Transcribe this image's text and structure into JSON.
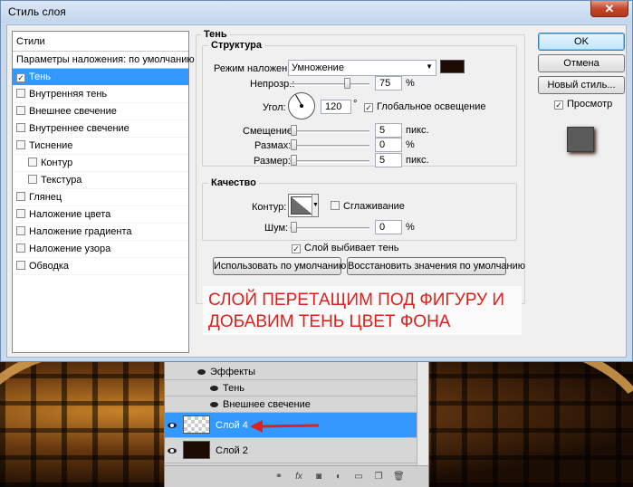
{
  "window": {
    "title": "Стиль слоя",
    "close_glyph": "✕"
  },
  "styles_panel": {
    "header": "Стили",
    "params_label": "Параметры наложения: по умолчанию",
    "items": [
      {
        "label": "Тень",
        "checked": true,
        "selected": true,
        "indent": false
      },
      {
        "label": "Внутренняя тень",
        "checked": false,
        "selected": false,
        "indent": false
      },
      {
        "label": "Внешнее свечение",
        "checked": false,
        "selected": false,
        "indent": false
      },
      {
        "label": "Внутреннее свечение",
        "checked": false,
        "selected": false,
        "indent": false
      },
      {
        "label": "Тиснение",
        "checked": false,
        "selected": false,
        "indent": false
      },
      {
        "label": "Контур",
        "checked": false,
        "selected": false,
        "indent": true
      },
      {
        "label": "Текстура",
        "checked": false,
        "selected": false,
        "indent": true
      },
      {
        "label": "Глянец",
        "checked": false,
        "selected": false,
        "indent": false
      },
      {
        "label": "Наложение цвета",
        "checked": false,
        "selected": false,
        "indent": false
      },
      {
        "label": "Наложение градиента",
        "checked": false,
        "selected": false,
        "indent": false
      },
      {
        "label": "Наложение узора",
        "checked": false,
        "selected": false,
        "indent": false
      },
      {
        "label": "Обводка",
        "checked": false,
        "selected": false,
        "indent": false
      }
    ]
  },
  "shadow": {
    "group_title": "Тень",
    "structure": {
      "title": "Структура",
      "blend_mode_label": "Режим наложения:",
      "blend_mode_value": "Умножение",
      "shadow_color": "#1d0c03",
      "opacity_label": "Непрозр.:",
      "opacity_value": "75",
      "opacity_unit": "%",
      "opacity_fraction": 0.75,
      "angle_label": "Угол:",
      "angle_value": "120",
      "angle_unit": "°",
      "global_light_label": "Глобальное освещение",
      "global_light_checked": true,
      "offset_label": "Смещение:",
      "offset_value": "5",
      "offset_unit": "пикс.",
      "spread_label": "Размах:",
      "spread_value": "0",
      "spread_unit": "%",
      "size_label": "Размер:",
      "size_value": "5",
      "size_unit": "пикс."
    },
    "quality": {
      "title": "Качество",
      "contour_label": "Контур:",
      "antialias_label": "Сглаживание",
      "antialias_checked": false,
      "noise_label": "Шум:",
      "noise_value": "0",
      "noise_unit": "%"
    },
    "knockout_label": "Слой выбивает тень",
    "knockout_checked": true,
    "use_default_button": "Использовать по умолчанию",
    "restore_default_button": "Восстановить значения по умолчанию"
  },
  "note": {
    "line1": "СЛОЙ ПЕРЕТАЩИМ ПОД ФИГУРУ И",
    "line2": "ДОБАВИМ ТЕНЬ ЦВЕТ ФОНА",
    "color": "#e0201a"
  },
  "right_panel": {
    "ok_button": "OK",
    "cancel_button": "Отмена",
    "new_style_button": "Новый стиль...",
    "preview_label": "Просмотр",
    "preview_checked": true
  },
  "layers_panel": {
    "effects_label": "Эффекты",
    "effect_items": [
      "Тень",
      "Внешнее свечение"
    ],
    "layers": [
      {
        "name": "Слой 4",
        "selected": true
      },
      {
        "name": "Слой 2",
        "selected": false
      }
    ],
    "accent_color": "#3399ff"
  }
}
